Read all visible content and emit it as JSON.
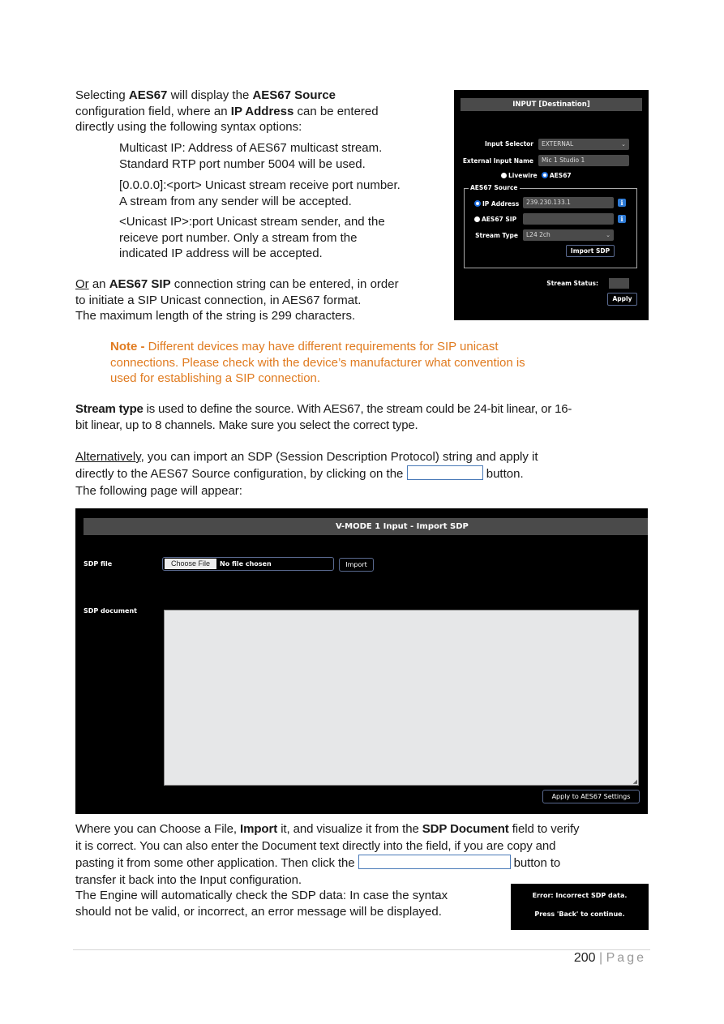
{
  "intro": {
    "line1_pre": "Selecting ",
    "line1_b1": "AES67",
    "line1_mid": " will display the ",
    "line1_b2": "AES67 Source",
    "line2_pre": "configuration field, where an ",
    "line2_b": "IP Address",
    "line2_post": " can be entered",
    "line3": "directly using the following syntax options:"
  },
  "syntax_options": [
    {
      "line1": "Multicast IP: Address of AES67 multicast stream.",
      "line2": "Standard RTP port number 5004 will be used."
    },
    {
      "line1": "[0.0.0.0]:<port> Unicast stream receive port number.",
      "line2": "A stream from any sender will be accepted."
    },
    {
      "line1": "<Unicast IP>:port Unicast stream sender, and the",
      "line2": "reiceve port number. Only a stream from the",
      "line3": "indicated IP address will be accepted."
    }
  ],
  "sip_para": {
    "or": "Or",
    "pre": " an ",
    "b": "AES67 SIP",
    "post": " connection string can be entered, in order",
    "line2": "to initiate a SIP Unicast connection, in AES67 format.",
    "line3": "The maximum length of the string is 299 characters."
  },
  "note": {
    "label": "Note -",
    "line1": " Different devices may have different requirements for SIP unicast",
    "line2": "connections. Please check with the device’s manufacturer what convention is",
    "line3": "used for establishing a SIP connection."
  },
  "stream_type_para": {
    "b": "Stream type",
    "line1": " is used to define the source. With AES67, the stream could be 24-bit linear, or 16-",
    "line2": "bit linear, up to 8 channels. Make sure you select the correct type."
  },
  "alt_para": {
    "u": "Alternatively",
    "line1": ", you can import an SDP (Session Description Protocol) string and apply it",
    "line2_pre": "directly to the AES67 Source configuration, by clicking on the ",
    "line2_post": " button.",
    "line3": "The following page will appear:"
  },
  "input_panel": {
    "header": "INPUT [Destination]",
    "input_selector_label": "Input Selector",
    "input_selector_value": "EXTERNAL",
    "external_name_label": "External Input Name",
    "external_name_value": "Mic 1 Studio 1",
    "radio_livewire": "Livewire",
    "radio_aes67": "AES67",
    "source_legend": "AES67 Source",
    "ip_label": "IP Address",
    "ip_value": "239.230.133.1",
    "sip_label": "AES67 SIP",
    "sip_value": "",
    "stream_type_label": "Stream Type",
    "stream_type_value": "L24 2ch",
    "import_sdp": "Import SDP",
    "stream_status_label": "Stream Status:",
    "apply": "Apply",
    "info_glyph": "i",
    "chevron_glyph": "⌄"
  },
  "sdp_page": {
    "title": "V-MODE  1 Input - Import SDP",
    "sdp_file_label": "SDP file",
    "choose_file": "Choose File",
    "no_file": "No file chosen",
    "import": "Import",
    "sdp_document_label": "SDP document",
    "sdp_document_value": "",
    "apply_button": "Apply to AES67 Settings"
  },
  "where_para": {
    "pre": "Where you can Choose a File, ",
    "b1": "Import",
    "mid": " it, and visualize it from the ",
    "b2": "SDP Document",
    "post": " field to verify",
    "line2": "it is correct. You can also enter the Document text directly into the field, if you are copy and",
    "line3_pre": "pasting it from some other application. Then click the ",
    "line3_post": " button to",
    "line4": "transfer it back into the Input configuration."
  },
  "engine_para": {
    "line1": "The Engine will automatically check the SDP data: In case the syntax",
    "line2": "should not be valid, or incorrect,  an error message will be displayed."
  },
  "error_box": {
    "line1": "Error: Incorrect SDP data.",
    "line2": "Press 'Back' to continue."
  },
  "footer": {
    "page_number": "200",
    "separator": " | ",
    "page_word": "Page"
  }
}
